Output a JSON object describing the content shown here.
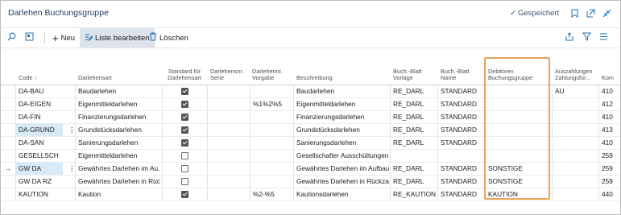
{
  "window": {
    "title": "Darlehen Buchungsgruppe",
    "saved_label": "Gespeichert"
  },
  "actions": {
    "new_label": "Neu",
    "edit_list_label": "Liste bearbeiten",
    "delete_label": "Löschen"
  },
  "columns": [
    {
      "key": "code",
      "label": "Code ↑"
    },
    {
      "key": "art",
      "label": "Darlehensart"
    },
    {
      "key": "std",
      "label": "Standard für Darlehensart"
    },
    {
      "key": "serie",
      "label": "Darlehensnr. Serie"
    },
    {
      "key": "vorlage",
      "label": "Darlehennr. Vorgabe"
    },
    {
      "key": "beschr",
      "label": "Beschreibung"
    },
    {
      "key": "bvorlage",
      "label": "Buch.-Blatt Vorlage"
    },
    {
      "key": "bname",
      "label": "Buch.-Blatt Name"
    },
    {
      "key": "debitor",
      "label": "Debitoren Buchungsgruppe"
    },
    {
      "key": "ausz",
      "label": "Auszahlungen Zahlungsfor..."
    },
    {
      "key": "kom",
      "label": "Kom"
    }
  ],
  "rows": [
    {
      "code": "DA-BAU",
      "art": "Baudarlehen",
      "std": true,
      "vorlage": "",
      "beschr": "Baudarlehen",
      "bvorlage": "RE_DARL",
      "bname": "STANDARD",
      "debitor": "",
      "ausz": "AU",
      "kom": "410"
    },
    {
      "code": "DA-EIGEN",
      "art": "Eigenmitteldarlehen",
      "std": true,
      "vorlage": "%1%2%5",
      "beschr": "Eigenmitteldarlehen",
      "bvorlage": "RE_DARL",
      "bname": "STANDARD",
      "debitor": "",
      "ausz": "",
      "kom": "412"
    },
    {
      "code": "DA-FIN",
      "art": "Finanzierungsdarlehen",
      "std": true,
      "vorlage": "",
      "beschr": "Finanzierungsdarlehen",
      "bvorlage": "RE_DARL",
      "bname": "STANDARD",
      "debitor": "",
      "ausz": "",
      "kom": "410"
    },
    {
      "code": "DA-GRUND",
      "art": "Grundstücksdarlehen",
      "std": true,
      "vorlage": "",
      "beschr": "Grundstücksdarlehen",
      "bvorlage": "RE_DARL",
      "bname": "STANDARD",
      "debitor": "",
      "ausz": "",
      "kom": "413"
    },
    {
      "code": "DA-SAN",
      "art": "Sanierungsdarlehen",
      "std": true,
      "vorlage": "",
      "beschr": "Sanierungsdarlehen",
      "bvorlage": "RE_DARL",
      "bname": "STANDARD",
      "debitor": "",
      "ausz": "",
      "kom": "410"
    },
    {
      "code": "GESELLSCH",
      "art": "Eigenmitteldarlehen",
      "std": false,
      "vorlage": "",
      "beschr": "Gesellschafter Ausschüttungen",
      "bvorlage": "",
      "bname": "",
      "debitor": "",
      "ausz": "",
      "kom": "259"
    },
    {
      "code": "GW DA",
      "art": "Gewährtes Darlehen im Au...",
      "std": false,
      "vorlage": "",
      "beschr": "Gewährtes Darlehen im Aufbau",
      "bvorlage": "RE_DARL",
      "bname": "STANDARD",
      "debitor": "SONSTIGE",
      "ausz": "",
      "kom": "259"
    },
    {
      "code": "GW DA RZ",
      "art": "Gewährtes Darlehen in Rück...",
      "std": false,
      "vorlage": "",
      "beschr": "Gewährtes Darlehen in Rückza...",
      "bvorlage": "RE_DARL",
      "bname": "STANDARD",
      "debitor": "SONSTIGE",
      "ausz": "",
      "kom": "259"
    },
    {
      "code": "KAUTION",
      "art": "Kaution",
      "std": true,
      "vorlage": "%2-%5",
      "beschr": "Kautionsdarlehen",
      "bvorlage": "RE_KAUTION",
      "bname": "STANDARD",
      "debitor": "KAUTION",
      "ausz": "",
      "kom": "440"
    }
  ],
  "selection": {
    "selected_row_index": 3,
    "current_row_index": 6
  },
  "colors": {
    "accent": "#1f6fb5",
    "highlight_border": "#e8a55a",
    "selected_cell": "#d7eaf5"
  }
}
